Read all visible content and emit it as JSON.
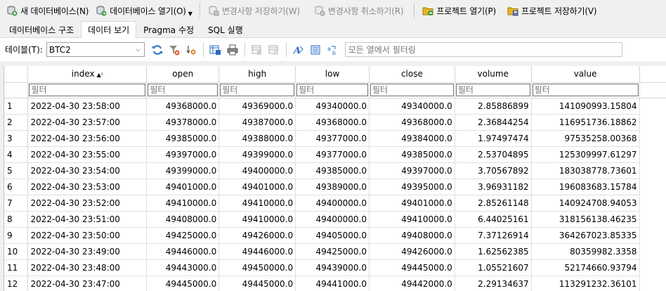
{
  "toolbar": {
    "new_db": "새 데이터베이스(N)",
    "open_db": "데이터베이스 열기(O)",
    "write_changes": "변경사항 저장하기(W)",
    "revert_changes": "변경사항 취소하기(R)",
    "open_project": "프로젝트 열기(P)",
    "save_project": "프로젝트 저장하기(V)"
  },
  "tabs": [
    {
      "label": "데이터베이스 구조"
    },
    {
      "label": "데이터 보기"
    },
    {
      "label": "Pragma 수정"
    },
    {
      "label": "SQL 실행"
    }
  ],
  "filterbar": {
    "table_label": "테이블(T):",
    "table_value": "BTC2",
    "filter_placeholder": "모든 열에서 필터링"
  },
  "grid": {
    "columns": [
      "index",
      "open",
      "high",
      "low",
      "close",
      "volume",
      "value"
    ],
    "sort_indicator": "▲¹",
    "filter_placeholder": "필터",
    "rows": [
      [
        "1",
        "2022-04-30 23:58:00",
        "49368000.0",
        "49369000.0",
        "49340000.0",
        "49340000.0",
        "2.85886899",
        "141090993.15804"
      ],
      [
        "2",
        "2022-04-30 23:57:00",
        "49378000.0",
        "49387000.0",
        "49368000.0",
        "49368000.0",
        "2.36844254",
        "116951736.18862"
      ],
      [
        "3",
        "2022-04-30 23:56:00",
        "49385000.0",
        "49388000.0",
        "49377000.0",
        "49384000.0",
        "1.97497474",
        "97535258.00368"
      ],
      [
        "4",
        "2022-04-30 23:55:00",
        "49397000.0",
        "49399000.0",
        "49377000.0",
        "49385000.0",
        "2.53704895",
        "125309997.61297"
      ],
      [
        "5",
        "2022-04-30 23:54:00",
        "49399000.0",
        "49400000.0",
        "49385000.0",
        "49397000.0",
        "3.70567892",
        "183038778.73601"
      ],
      [
        "6",
        "2022-04-30 23:53:00",
        "49401000.0",
        "49401000.0",
        "49389000.0",
        "49395000.0",
        "3.96931182",
        "196083683.15784"
      ],
      [
        "7",
        "2022-04-30 23:52:00",
        "49410000.0",
        "49410000.0",
        "49400000.0",
        "49401000.0",
        "2.85261148",
        "140924708.94053"
      ],
      [
        "8",
        "2022-04-30 23:51:00",
        "49408000.0",
        "49410000.0",
        "49400000.0",
        "49410000.0",
        "6.44025161",
        "318156138.46235"
      ],
      [
        "9",
        "2022-04-30 23:50:00",
        "49425000.0",
        "49426000.0",
        "49405000.0",
        "49408000.0",
        "7.37126914",
        "364267023.85335"
      ],
      [
        "10",
        "2022-04-30 23:49:00",
        "49446000.0",
        "49446000.0",
        "49425000.0",
        "49426000.0",
        "1.62562385",
        "80359982.3358"
      ],
      [
        "11",
        "2022-04-30 23:48:00",
        "49443000.0",
        "49450000.0",
        "49439000.0",
        "49445000.0",
        "1.05521607",
        "52174660.93794"
      ],
      [
        "12",
        "2022-04-30 23:47:00",
        "49445000.0",
        "49445000.0",
        "49441000.0",
        "49442000.0",
        "2.29134637",
        "113291232.36101"
      ]
    ]
  },
  "colors": {
    "accent_blue": "#2b6cc4",
    "db_green": "#3a9a3a",
    "project_yellow": "#e8b62c",
    "disabled_gray": "#8a8a8a"
  }
}
